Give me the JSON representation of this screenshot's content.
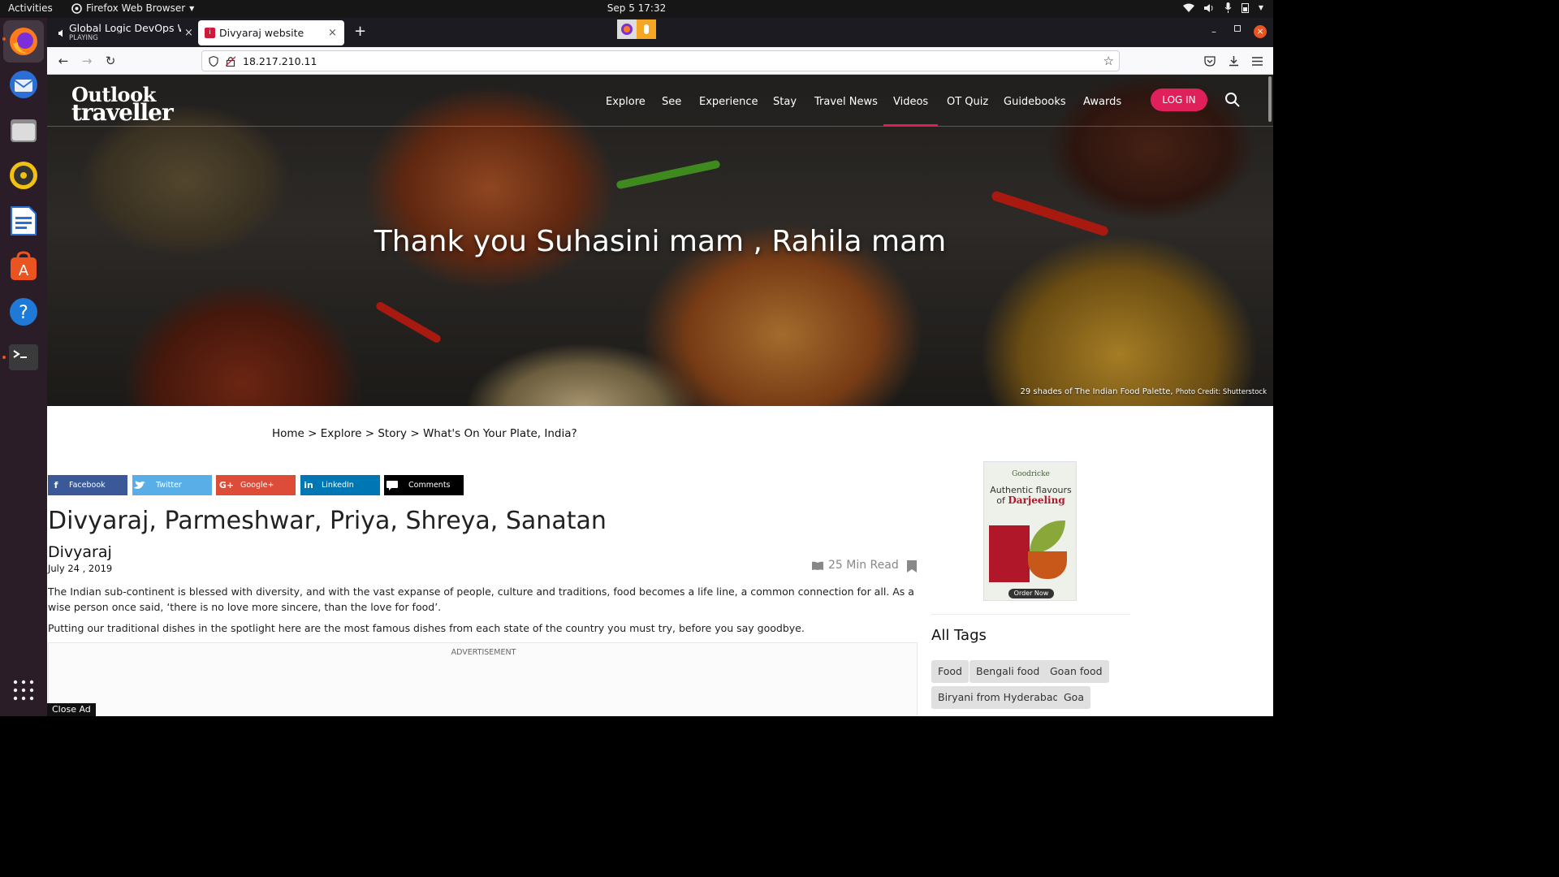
{
  "system": {
    "activities": "Activities",
    "app_menu": "Firefox Web Browser",
    "clock": "Sep 5  17:32"
  },
  "browser": {
    "tabs": [
      {
        "title": "Global Logic DevOps Wa",
        "status": "PLAYING"
      },
      {
        "title": "Divyaraj website"
      }
    ],
    "url": "18.217.210.11"
  },
  "site": {
    "logo_line1": "Outlook",
    "logo_line2": "traveller",
    "nav": [
      "Explore",
      "See",
      "Experience",
      "Stay",
      "Travel News",
      "Videos",
      "OT Quiz",
      "Guidebooks",
      "Awards"
    ],
    "nav_active": "Videos",
    "login_label": "LOG IN",
    "accent_color": "#e0205a"
  },
  "hero": {
    "title": "Thank you Suhasini mam , Rahila mam",
    "caption": "29 shades of The Indian Food Palette,",
    "credit": "Photo Credit: Shutterstock"
  },
  "breadcrumb": [
    "Home",
    "Explore",
    "Story",
    "What's On Your Plate, India?"
  ],
  "share": [
    "Facebook",
    "Twitter",
    "Google+",
    "LinkedIn",
    "Comments"
  ],
  "article": {
    "title": "Divyaraj, Parmeshwar, Priya, Shreya, Sanatan",
    "author": "Divyaraj",
    "date": "July 24 , 2019",
    "read_time": "25 Min Read",
    "paragraphs": [
      "The Indian sub-continent is blessed with diversity, and with the vast expanse of people, culture and traditions, food becomes a life line, a common connection for all. As a wise person once said, ‘there is no love more sincere, than the love for food’.",
      "Putting our traditional dishes in the spotlight here are the most famous dishes from each state of the country you must try, before you say goodbye."
    ]
  },
  "ad": {
    "label": "ADVERTISEMENT",
    "close_label": "Close Ad"
  },
  "side_ad": {
    "brand": "Goodricke",
    "line1": "Authentic flavours",
    "line2": "of",
    "line3": "Darjeeling",
    "button": "Order Now"
  },
  "tags": {
    "title": "All Tags",
    "items": [
      "Food",
      "Bengali food",
      "Goan food",
      "Biryani from Hyderabad",
      "Goa"
    ]
  }
}
